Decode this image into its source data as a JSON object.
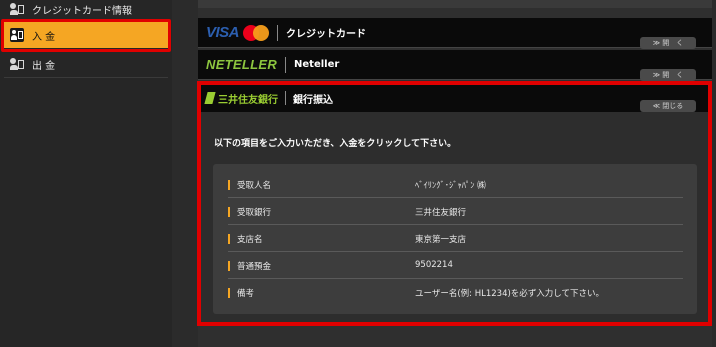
{
  "sidebar": {
    "items": [
      {
        "label": "クレジットカード情報",
        "icon": "credit-card-user-icon"
      },
      {
        "label": "入 金",
        "icon": "deposit-icon"
      },
      {
        "label": "出 金",
        "icon": "withdraw-icon"
      }
    ]
  },
  "payment_methods": [
    {
      "brand": "VISA",
      "label": "クレジットカード",
      "toggle": "≫ 開　く"
    },
    {
      "brand": "NETELLER",
      "label": "Neteller",
      "toggle": "≫ 開　く"
    }
  ],
  "bank": {
    "brand": "三井住友銀行",
    "label": "銀行振込",
    "toggle": "≪ 閉じる",
    "instruction": "以下の項目をご入力いただき、入金をクリックして下さい。",
    "rows": [
      {
        "key": "受取人名",
        "value": "ﾍﾞｲﾘﾝｸﾞ･ｼﾞｬﾊﾟﾝ ㈱"
      },
      {
        "key": "受取銀行",
        "value": "三井住友銀行"
      },
      {
        "key": "支店名",
        "value": "東京第一支店"
      },
      {
        "key": "普通預金",
        "value": "9502214"
      },
      {
        "key": "備考",
        "value": "ユーザー名(例: HL1234)を必ず入力して下さい。"
      }
    ]
  },
  "colors": {
    "accent": "#f5a623",
    "highlight": "#e00000",
    "neteller": "#8dc63f",
    "visa": "#2c5fb0"
  }
}
